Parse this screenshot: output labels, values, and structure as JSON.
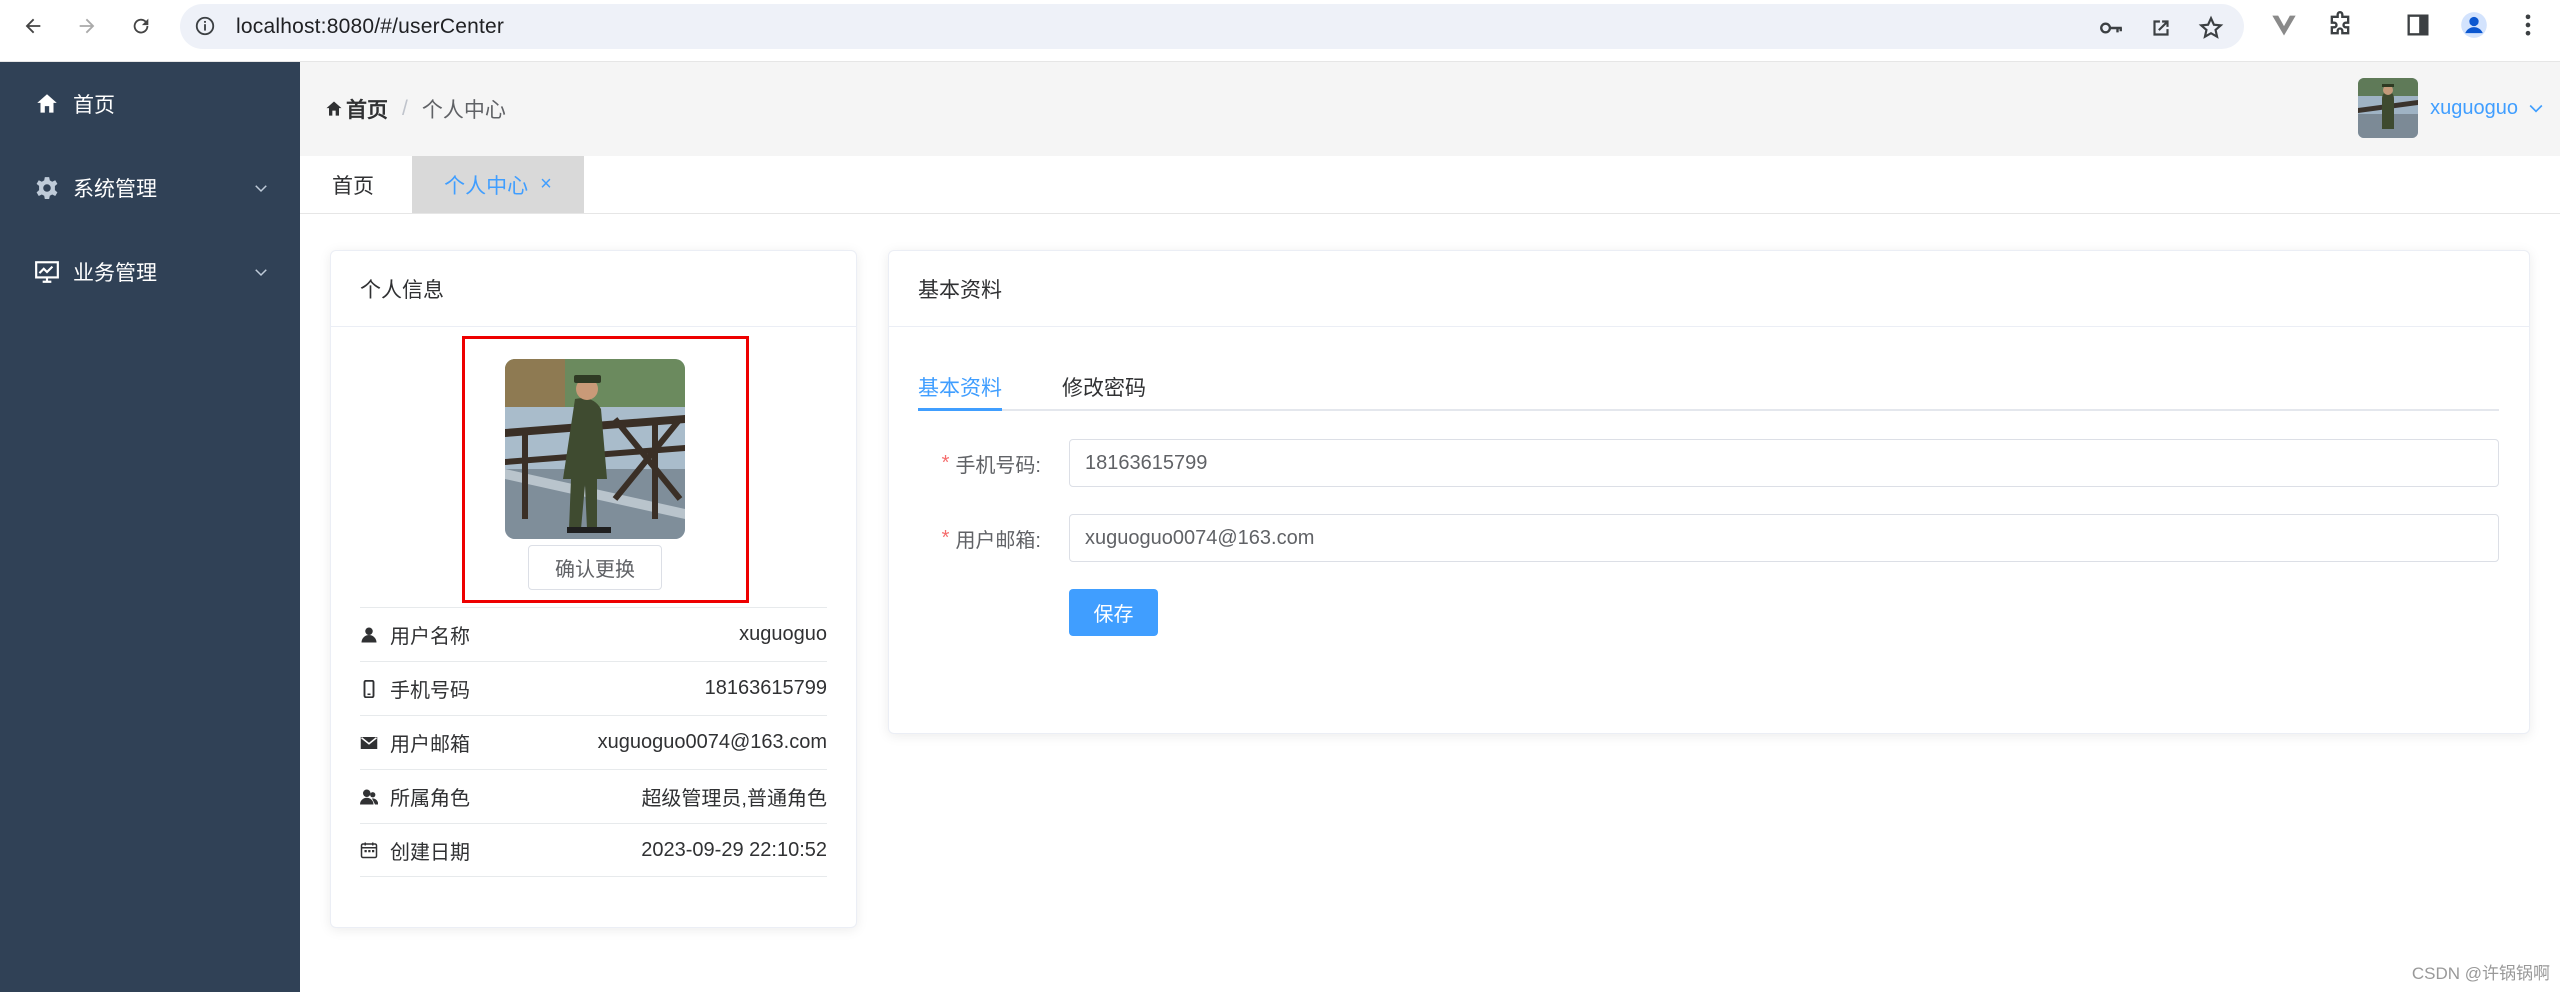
{
  "browser": {
    "url": "localhost:8080/#/userCenter"
  },
  "sidebar": {
    "items": [
      {
        "label": "首页",
        "icon": "home-icon"
      },
      {
        "label": "系统管理",
        "icon": "gear-icon"
      },
      {
        "label": "业务管理",
        "icon": "monitor-icon"
      }
    ]
  },
  "navbar": {
    "breadcrumb": {
      "home": "首页",
      "separator": "/",
      "current": "个人中心"
    },
    "username": "xuguoguo"
  },
  "tags": {
    "home": "首页",
    "active": "个人中心",
    "close": "×"
  },
  "profile_card": {
    "title": "个人信息",
    "confirm_button": "确认更换",
    "rows": [
      {
        "label": "用户名称",
        "value": "xuguoguo",
        "icon": "user-icon"
      },
      {
        "label": "手机号码",
        "value": "18163615799",
        "icon": "phone-icon"
      },
      {
        "label": "用户邮箱",
        "value": "xuguoguo0074@163.com",
        "icon": "mail-icon"
      },
      {
        "label": "所属角色",
        "value": "超级管理员,普通角色",
        "icon": "users-icon"
      },
      {
        "label": "创建日期",
        "value": "2023-09-29 22:10:52",
        "icon": "calendar-icon"
      }
    ]
  },
  "basic_card": {
    "title": "基本资料",
    "tabs": [
      "基本资料",
      "修改密码"
    ],
    "fields": [
      {
        "required": "*",
        "label": "手机号码:",
        "value": "18163615799"
      },
      {
        "required": "*",
        "label": "用户邮箱:",
        "value": "xuguoguo0074@163.com"
      }
    ],
    "save_button": "保存"
  },
  "watermark": "CSDN @许锅锅啊",
  "colors": {
    "sidebar_bg": "#304156",
    "primary": "#409eff",
    "highlight_border": "#ee0000"
  }
}
